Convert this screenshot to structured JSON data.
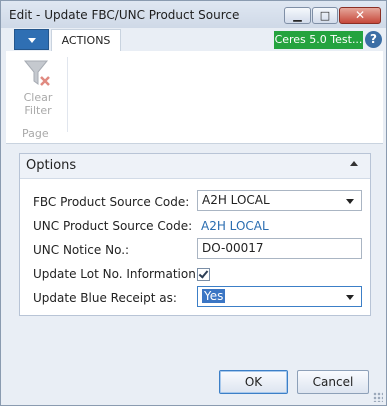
{
  "window": {
    "title": "Edit - Update FBC/UNC Product Source"
  },
  "ribbon": {
    "tab_label": "ACTIONS",
    "company_badge": "Ceres 5.0 Test...",
    "help_label": "?",
    "clear_filter": {
      "line1": "Clear",
      "line2": "Filter"
    },
    "group_label": "Page"
  },
  "options": {
    "header": "Options",
    "fbc_label": "FBC Product Source Code:",
    "fbc_value": "A2H LOCAL",
    "unc_label": "UNC Product Source Code:",
    "unc_value": "A2H LOCAL",
    "notice_label": "UNC Notice No.:",
    "notice_value": "DO-00017",
    "lot_label": "Update Lot No. Information:",
    "lot_checked": true,
    "blue_label": "Update Blue Receipt as:",
    "blue_value": "Yes"
  },
  "buttons": {
    "ok": "OK",
    "cancel": "Cancel"
  },
  "colors": {
    "accent": "#2f6fb3",
    "badge": "#24a33e",
    "link": "#2a6db0"
  }
}
